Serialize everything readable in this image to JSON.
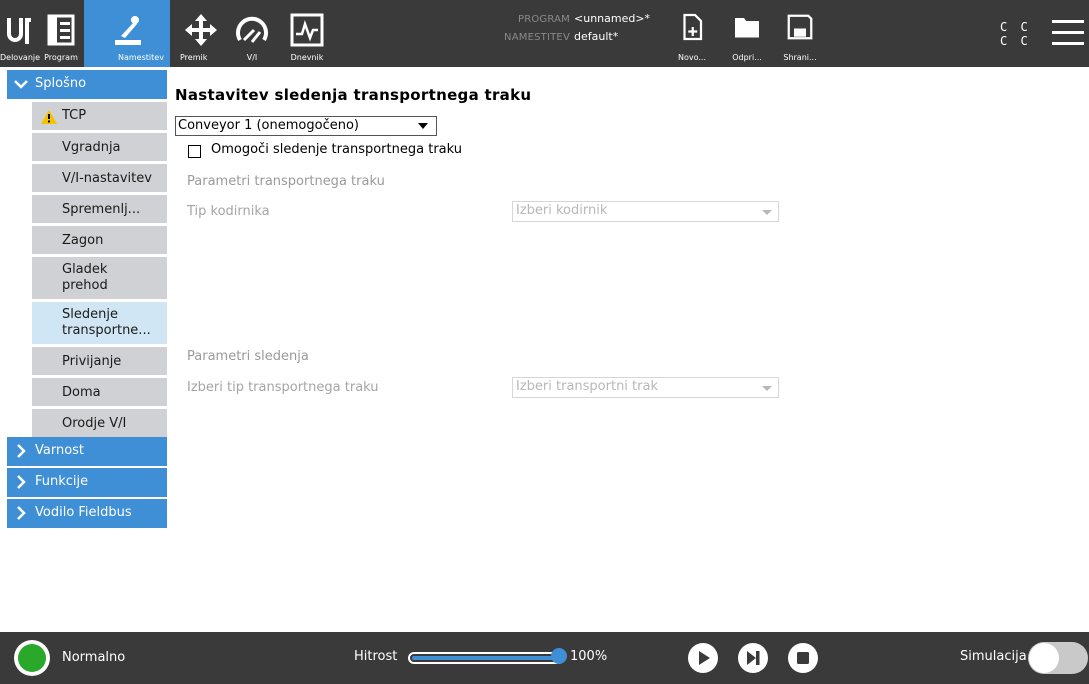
{
  "topbar": {
    "tabs": [
      {
        "label": "Delovanje",
        "icon": "ur-logo-icon"
      },
      {
        "label": "Program",
        "icon": "program-tree-icon"
      },
      {
        "label": "Namestitev",
        "icon": "robot-arm-icon",
        "active": true
      }
    ],
    "tools": [
      {
        "label": "Premik",
        "icon": "move-arrows-icon"
      },
      {
        "label": "V/I",
        "icon": "io-gauge-icon"
      },
      {
        "label": "Dnevnik",
        "icon": "log-pulse-icon"
      }
    ],
    "program_key": "PROGRAM",
    "program_value": "<unnamed>*",
    "install_key": "NAMESTITEV",
    "install_value": "default*",
    "file_buttons": [
      {
        "label": "Novo...",
        "icon": "new-file-icon"
      },
      {
        "label": "Odpri...",
        "icon": "folder-icon"
      },
      {
        "label": "Shrani...",
        "icon": "save-disk-icon"
      }
    ],
    "cc_row1": "C C",
    "cc_row2": "C C"
  },
  "sidebar": {
    "sections": [
      {
        "label": "Splošno",
        "expanded": true
      },
      {
        "label": "Varnost",
        "expanded": false
      },
      {
        "label": "Funkcije",
        "expanded": false
      },
      {
        "label": "Vodilo Fieldbus",
        "expanded": false
      }
    ],
    "items": [
      {
        "label": "TCP",
        "warning": true
      },
      {
        "label": "Vgradnja"
      },
      {
        "label": "V/I-nastavitev"
      },
      {
        "label": "Spremenlj..."
      },
      {
        "label": "Zagon"
      },
      {
        "label": "Gladek prehod"
      },
      {
        "label": "Sledenje transportne...",
        "selected": true
      },
      {
        "label": "Privijanje"
      },
      {
        "label": "Doma"
      },
      {
        "label": "Orodje V/I"
      }
    ]
  },
  "main": {
    "title": "Nastavitev sledenja transportnega traku",
    "conveyor_select": "Conveyor 1 (onemogočeno)",
    "enable_checkbox_label": "Omogoči sledenje transportnega traku",
    "enable_checked": false,
    "conveyor_params_heading": "Parametri transportnega traku",
    "encoder_label": "Tip kodirnika",
    "encoder_placeholder": "Izberi kodirnik",
    "tracking_params_heading": "Parametri sledenja",
    "conveyor_type_label": "Izberi tip transportnega traku",
    "conveyor_type_placeholder": "Izberi transportni trak"
  },
  "bottombar": {
    "status": "Normalno",
    "status_color": "#2aa82a",
    "speed_label": "Hitrost",
    "speed_value": "100%",
    "speed_fraction": 1.0,
    "simulation_label": "Simulacija",
    "simulation_on": false
  },
  "colors": {
    "accent": "#3e8fd6",
    "topbar_bg": "#3a3a3a",
    "selected_item": "#d1e6f5"
  }
}
